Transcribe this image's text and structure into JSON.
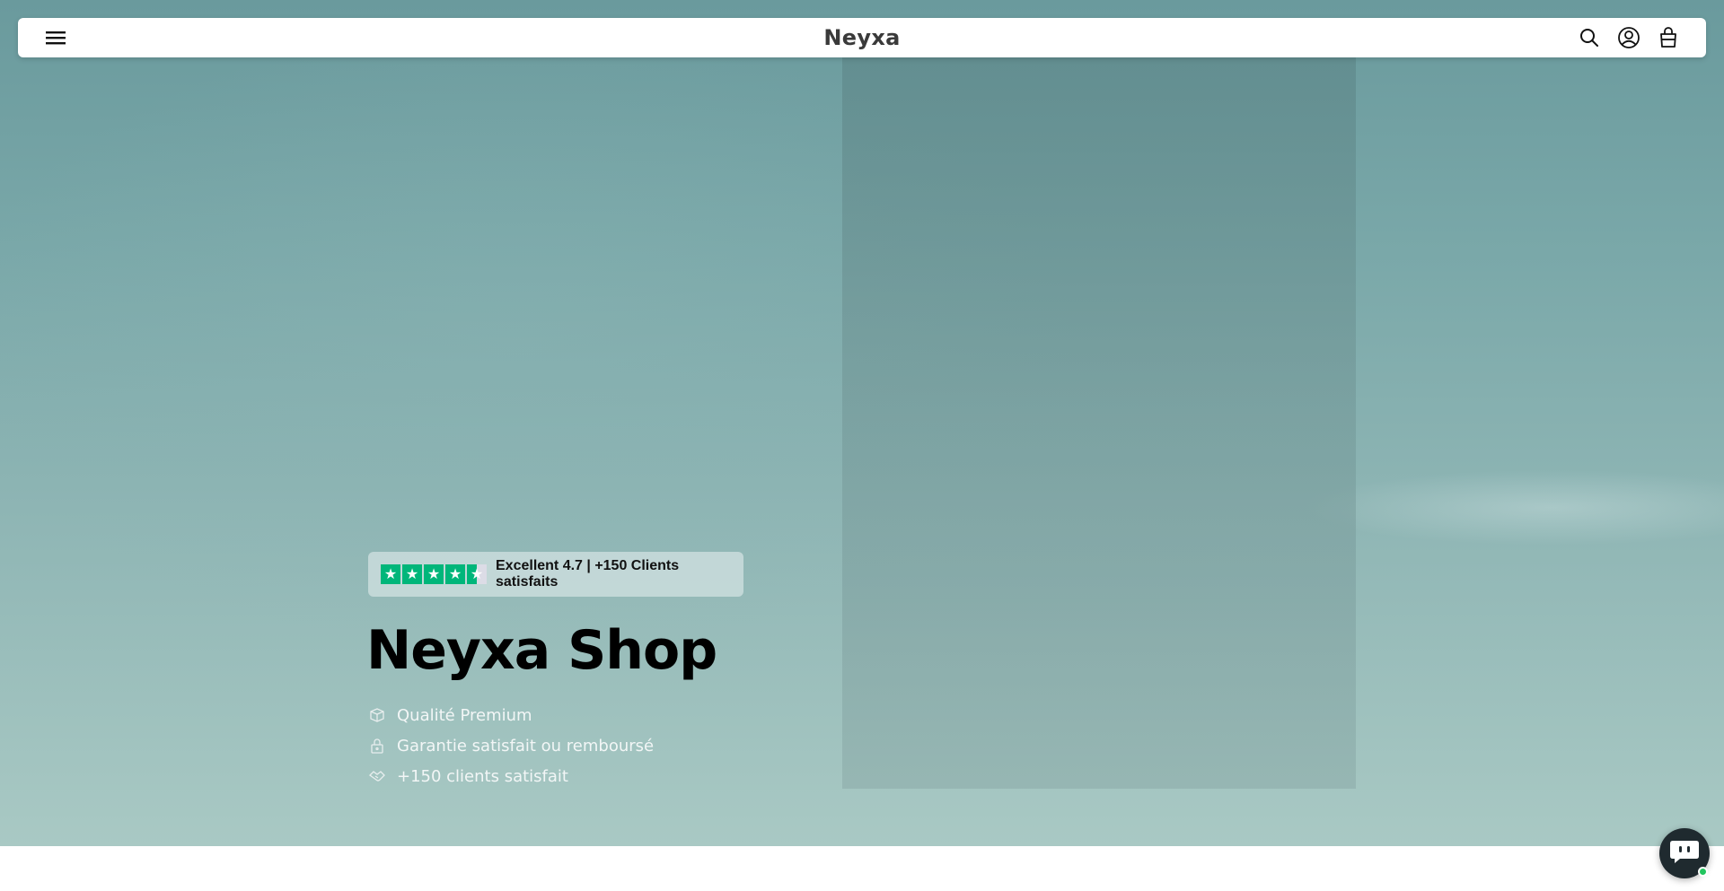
{
  "header": {
    "brand": "Neyxa",
    "icons": [
      "menu-icon",
      "search-icon",
      "account-icon",
      "cart-icon"
    ]
  },
  "hero": {
    "rating": {
      "stars": 4.5,
      "text": "Excellent 4.7 | +150 Clients satisfaits",
      "star_color": "#00b67a"
    },
    "title": "Neyxa Shop",
    "features": [
      {
        "icon": "box-icon",
        "text": "Qualité Premium"
      },
      {
        "icon": "lock-icon",
        "text": "Garantie satisfait ou remboursé"
      },
      {
        "icon": "handshake-icon",
        "text": "+150 clients satisfait"
      }
    ]
  },
  "chat": {
    "icon": "chat-bot-icon",
    "status_color": "#22c55e"
  }
}
